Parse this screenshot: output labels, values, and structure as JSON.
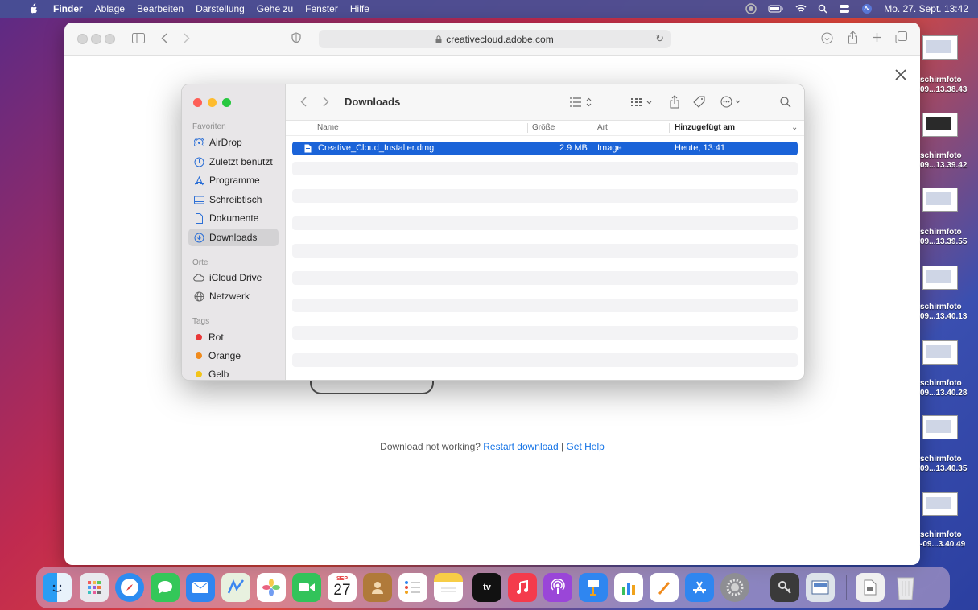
{
  "menubar": {
    "items": [
      "Finder",
      "Ablage",
      "Bearbeiten",
      "Darstellung",
      "Gehe zu",
      "Fenster",
      "Hilfe"
    ],
    "clock": "Mo. 27. Sept. 13:42"
  },
  "browser": {
    "url": "creativecloud.adobe.com",
    "help_text": "Download not working?",
    "restart_link": "Restart download",
    "separator": "|",
    "help_link": "Get Help"
  },
  "finder": {
    "title": "Downloads",
    "sidebar": {
      "favorites_header": "Favoriten",
      "favorites": [
        "AirDrop",
        "Zuletzt benutzt",
        "Programme",
        "Schreibtisch",
        "Dokumente",
        "Downloads"
      ],
      "places_header": "Orte",
      "places": [
        "iCloud Drive",
        "Netzwerk"
      ],
      "tags_header": "Tags",
      "tags": [
        {
          "label": "Rot",
          "color": "#e93838"
        },
        {
          "label": "Orange",
          "color": "#f08a1c"
        },
        {
          "label": "Gelb",
          "color": "#f2c418"
        }
      ]
    },
    "columns": {
      "name": "Name",
      "size": "Größe",
      "kind": "Art",
      "added": "Hinzugefügt am"
    },
    "files": [
      {
        "name": "Creative_Cloud_Installer.dmg",
        "size": "2.9 MB",
        "kind": "Image",
        "added": "Heute, 13:41"
      }
    ]
  },
  "desktop_files": [
    {
      "line1": "schirmfoto",
      "line2": "09...13.38.43"
    },
    {
      "line1": "schirmfoto",
      "line2": "09...13.39.42"
    },
    {
      "line1": "schirmfoto",
      "line2": "09...13.39.55"
    },
    {
      "line1": "schirmfoto",
      "line2": "09...13.40.13"
    },
    {
      "line1": "schirmfoto",
      "line2": "09...13.40.28"
    },
    {
      "line1": "schirmfoto",
      "line2": "09...13.40.35"
    },
    {
      "line1": "schirmfoto",
      "line2": "-09...3.40.49"
    }
  ],
  "dock": {
    "calendar_month": "SEP",
    "calendar_day": "27",
    "tv_label": "tv"
  }
}
